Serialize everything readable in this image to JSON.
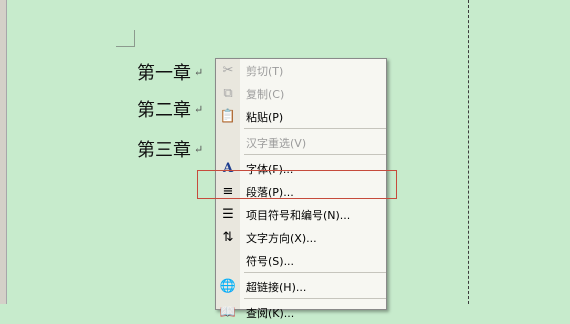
{
  "document": {
    "headings": [
      "第一章",
      "第二章",
      "第三章"
    ],
    "paragraph_mark": "↵"
  },
  "context_menu": {
    "items": [
      {
        "label": "剪切(T)",
        "icon": "scissors-icon",
        "glyph": "✂",
        "enabled": false
      },
      {
        "label": "复制(C)",
        "icon": "copy-icon",
        "glyph": "⧉",
        "enabled": false
      },
      {
        "label": "粘贴(P)",
        "icon": "paste-icon",
        "glyph": "📋",
        "enabled": true
      },
      {
        "label": "汉字重选(V)",
        "icon": "",
        "glyph": "",
        "enabled": false
      },
      {
        "label": "字体(F)...",
        "icon": "font-icon",
        "glyph": "A",
        "enabled": true
      },
      {
        "label": "段落(P)...",
        "icon": "paragraph-icon",
        "glyph": "≡",
        "enabled": true
      },
      {
        "label": "项目符号和编号(N)...",
        "icon": "bullets-icon",
        "glyph": "☰",
        "enabled": true
      },
      {
        "label": "文字方向(X)...",
        "icon": "text-direction-icon",
        "glyph": "⇅",
        "enabled": true
      },
      {
        "label": "符号(S)...",
        "icon": "",
        "glyph": "",
        "enabled": true
      },
      {
        "label": "超链接(H)...",
        "icon": "hyperlink-icon",
        "glyph": "🌐",
        "enabled": true
      },
      {
        "label": "查阅(K)...",
        "icon": "research-icon",
        "glyph": "📖",
        "enabled": true
      }
    ]
  },
  "colors": {
    "page_background": "#c7ebcc",
    "highlight_border": "#c64b3c"
  }
}
